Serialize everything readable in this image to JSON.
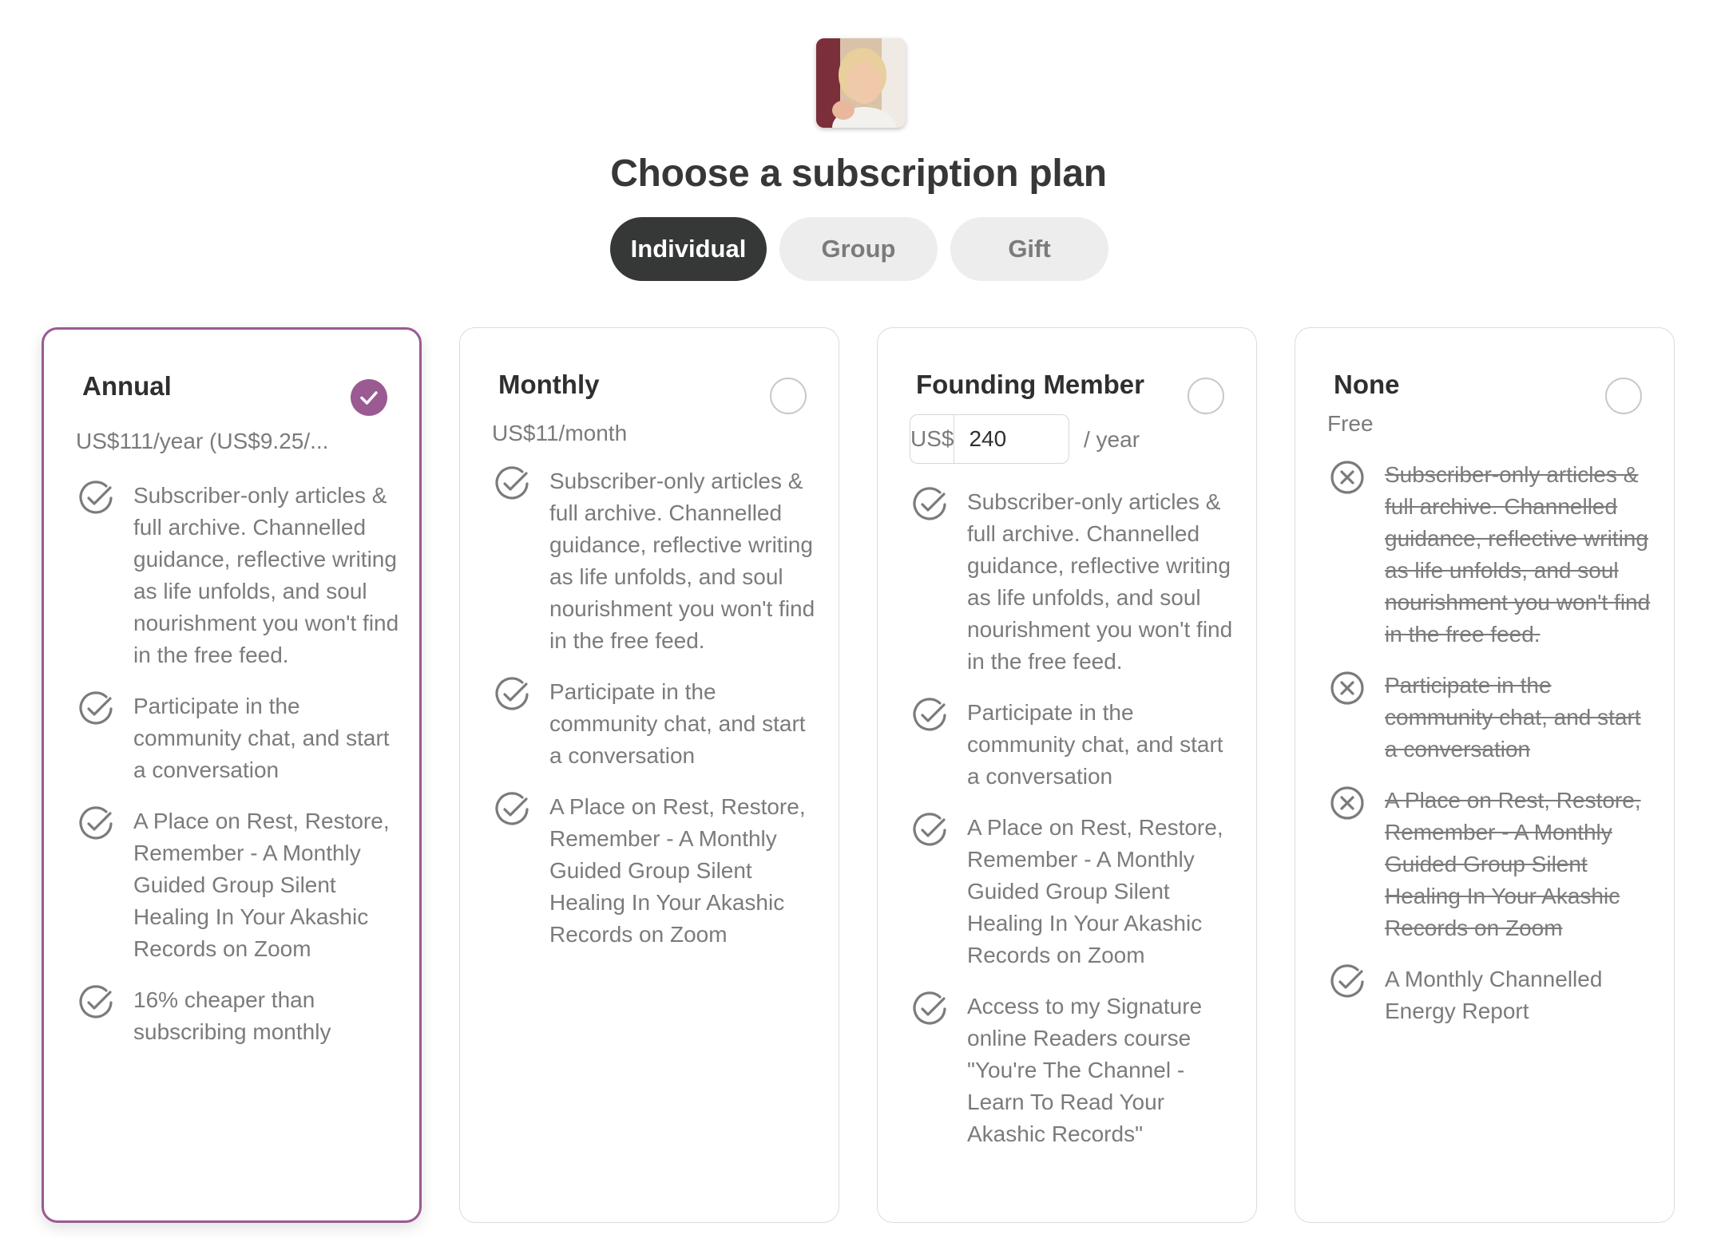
{
  "page": {
    "title": "Choose a subscription plan"
  },
  "tabs": [
    {
      "label": "Individual",
      "active": true
    },
    {
      "label": "Group",
      "active": false
    },
    {
      "label": "Gift",
      "active": false
    }
  ],
  "colors": {
    "accent": "#9a5a92",
    "text_dark": "#363737",
    "text_muted": "#7b7b7b",
    "tab_inactive_bg": "#ededed"
  },
  "plans": [
    {
      "name": "Annual",
      "selected": true,
      "price": "US$111/year (US$9.25/...",
      "features": [
        {
          "icon": "check-circle-icon",
          "text": "Subscriber-only articles & full archive. Channelled guidance, reflective writing as life unfolds, and soul nourishment you won't find in the free feed."
        },
        {
          "icon": "check-circle-icon",
          "text": "Participate in the community chat, and start a conversation"
        },
        {
          "icon": "check-circle-icon",
          "text": "A Place on Rest, Restore, Remember - A Monthly Guided Group Silent Healing In Your Akashic Records on Zoom"
        },
        {
          "icon": "check-circle-icon",
          "text": "16% cheaper than subscribing monthly"
        }
      ]
    },
    {
      "name": "Monthly",
      "selected": false,
      "price": "US$11/month",
      "features": [
        {
          "icon": "check-circle-icon",
          "text": "Subscriber-only articles & full archive. Channelled guidance, reflective writing as life unfolds, and soul nourishment you won't find in the free feed."
        },
        {
          "icon": "check-circle-icon",
          "text": "Participate in the community chat, and start a conversation"
        },
        {
          "icon": "check-circle-icon",
          "text": "A Place on Rest, Restore, Remember - A Monthly Guided Group Silent Healing In Your Akashic Records on Zoom"
        }
      ]
    },
    {
      "name": "Founding Member",
      "selected": false,
      "price_currency": "US$",
      "price_value": "240",
      "price_unit": "/ year",
      "features": [
        {
          "icon": "check-circle-icon",
          "text": "Subscriber-only articles & full archive. Channelled guidance, reflective writing as life unfolds, and soul nourishment you won't find in the free feed."
        },
        {
          "icon": "check-circle-icon",
          "text": "Participate in the community chat, and start a conversation"
        },
        {
          "icon": "check-circle-icon",
          "text": "A Place on Rest, Restore, Remember - A Monthly Guided Group Silent Healing In Your Akashic Records on Zoom"
        },
        {
          "icon": "check-circle-icon",
          "text": "Access to my Signature online Readers course \"You're The Channel - Learn To Read Your Akashic Records\""
        }
      ]
    },
    {
      "name": "None",
      "selected": false,
      "price": "Free",
      "features": [
        {
          "icon": "x-circle-icon",
          "text": "Subscriber-only articles & full archive. Channelled guidance, reflective writing as life unfolds, and soul nourishment you won't find in the free feed.",
          "excluded": true
        },
        {
          "icon": "x-circle-icon",
          "text": "Participate in the community chat, and start a conversation",
          "excluded": true
        },
        {
          "icon": "x-circle-icon",
          "text": "A Place on Rest, Restore, Remember - A Monthly Guided Group Silent Healing In Your Akashic Records on Zoom",
          "excluded": true
        },
        {
          "icon": "check-circle-icon",
          "text": "A Monthly Channelled Energy Report"
        }
      ]
    }
  ]
}
